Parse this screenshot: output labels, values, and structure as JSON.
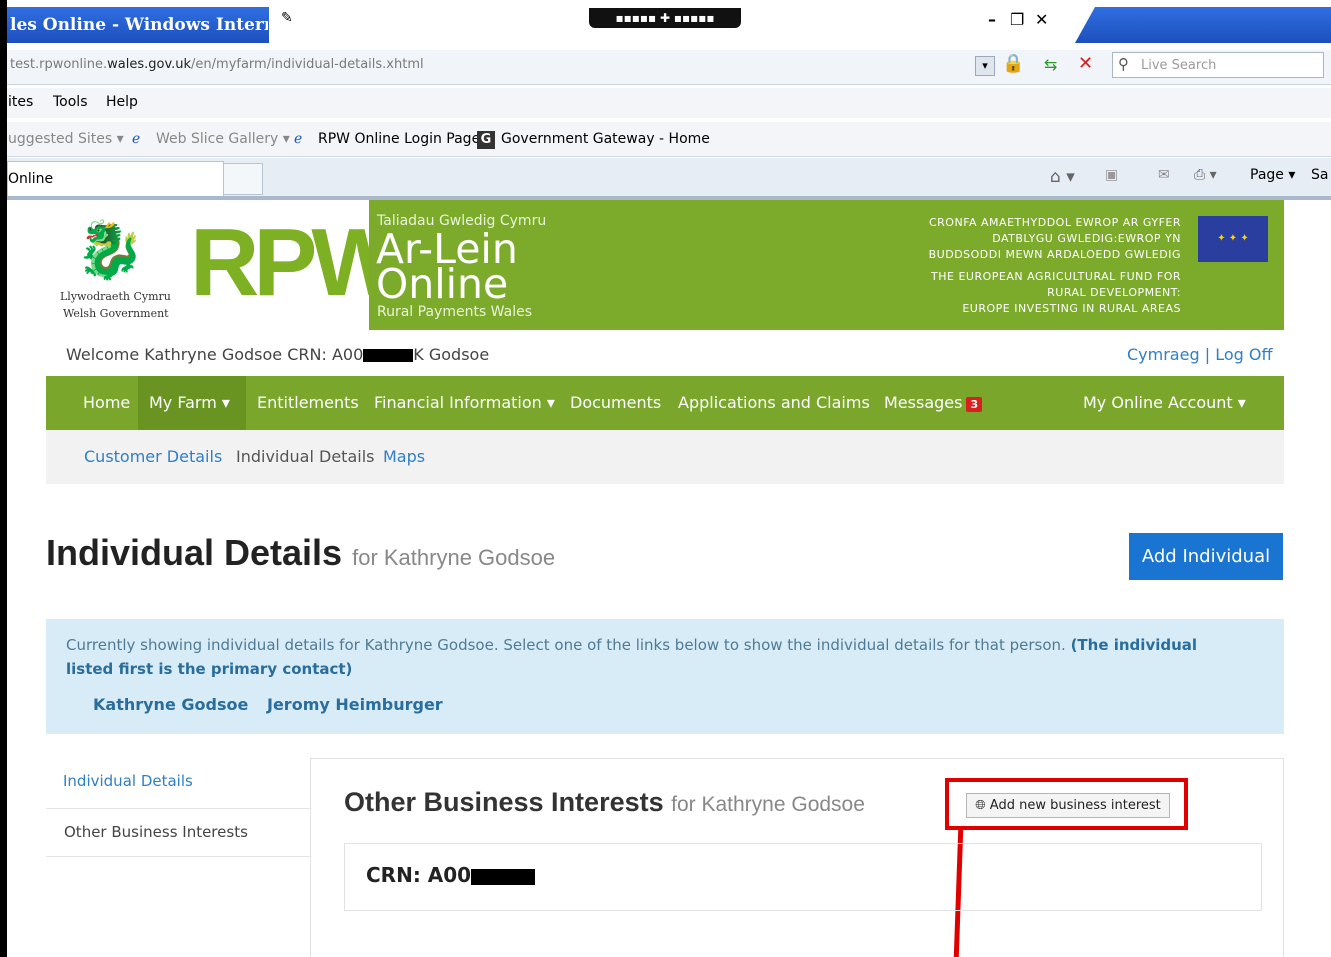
{
  "browser": {
    "title": "les Online - Windows Internet E",
    "url_prefix": "test.rpwonline.",
    "url_domain": "wales.gov.uk",
    "url_path": "/en/myfarm/individual-details.xhtml",
    "search_placeholder": "Live Search",
    "menu": [
      "ites",
      "Tools",
      "Help"
    ],
    "favorites": [
      "uggested Sites ▾",
      "Web Slice Gallery ▾",
      "RPW Online Login Page",
      "Government Gateway - Home"
    ],
    "tab_label": "Online",
    "page_menu": "Page ▾",
    "cut_text": "Sa"
  },
  "header": {
    "gov_line1": "Llywodraeth Cymru",
    "gov_line2": "Welsh Government",
    "rpw": "RPW",
    "welsh_title": "Taliadau Gwledig Cymru",
    "arlein": "Ar-Lein",
    "online": "Online",
    "rural": "Rural Payments Wales",
    "eu_lines": [
      "CRONFA AMAETHYDDOL EWROP AR GYFER",
      "DATBLYGU GWLEDIG:EWROP YN",
      "BUDDSODDI MEWN ARDALOEDD GWLEDIG",
      "THE EUROPEAN AGRICULTURAL FUND FOR",
      "RURAL DEVELOPMENT:",
      "EUROPE INVESTING IN RURAL AREAS"
    ]
  },
  "welcome": {
    "prefix": "Welcome Kathryne Godsoe CRN: A00",
    "suffix": "K Godsoe",
    "cymraeg": "Cymraeg",
    "separator": "|",
    "logoff": "Log Off"
  },
  "nav": {
    "home": "Home",
    "myfarm": "My Farm ▾",
    "entitlements": "Entitlements",
    "financial": "Financial Information ▾",
    "documents": "Documents",
    "applications": "Applications and Claims",
    "messages": "Messages",
    "messages_count": "3",
    "account": "My Online Account ▾"
  },
  "subnav": {
    "customer": "Customer Details",
    "individual": "Individual Details",
    "maps": "Maps"
  },
  "page": {
    "title": "Individual Details",
    "title_for": "for Kathryne Godsoe",
    "add_button": "Add Individual",
    "info_text": "Currently showing individual details for Kathryne Godsoe. Select one of the links below to show the individual details for that person.",
    "info_bold": "(The individual listed first is the primary contact)",
    "persons": [
      "Kathryne Godsoe",
      "Jeromy Heimburger"
    ]
  },
  "sidebar": {
    "items": [
      "Individual Details",
      "Other Business Interests"
    ]
  },
  "panel": {
    "title": "Other Business Interests",
    "title_for": "for Kathryne Godsoe",
    "add_button": "Add new business interest",
    "crn_label": "CRN: A00"
  },
  "colors": {
    "green": "#7aa62b",
    "blue_button": "#1a74d1",
    "highlight": "#e00000"
  }
}
